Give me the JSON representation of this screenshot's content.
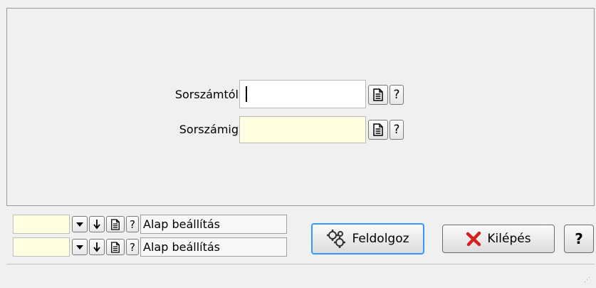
{
  "form": {
    "from_label": "Sorszámtól",
    "to_label": "Sorszámig",
    "from_value": "",
    "to_value": "",
    "help_glyph": "?"
  },
  "settings_rows": [
    {
      "value": "",
      "label": "Alap beállítás"
    },
    {
      "value": "",
      "label": "Alap beállítás"
    }
  ],
  "buttons": {
    "process_label": "Feldolgoz",
    "exit_label": "Kilépés",
    "help_label": "?"
  },
  "icons": {
    "document": "document-icon",
    "dropdown": "dropdown-arrow-icon",
    "down_arrow": "down-arrow-icon",
    "gears": "gears-icon",
    "exit": "red-x-icon",
    "help": "question-icon"
  },
  "colors": {
    "field_yellow": "#ffffe1",
    "focus_border": "#3399ff",
    "exit_red": "#d42020"
  }
}
